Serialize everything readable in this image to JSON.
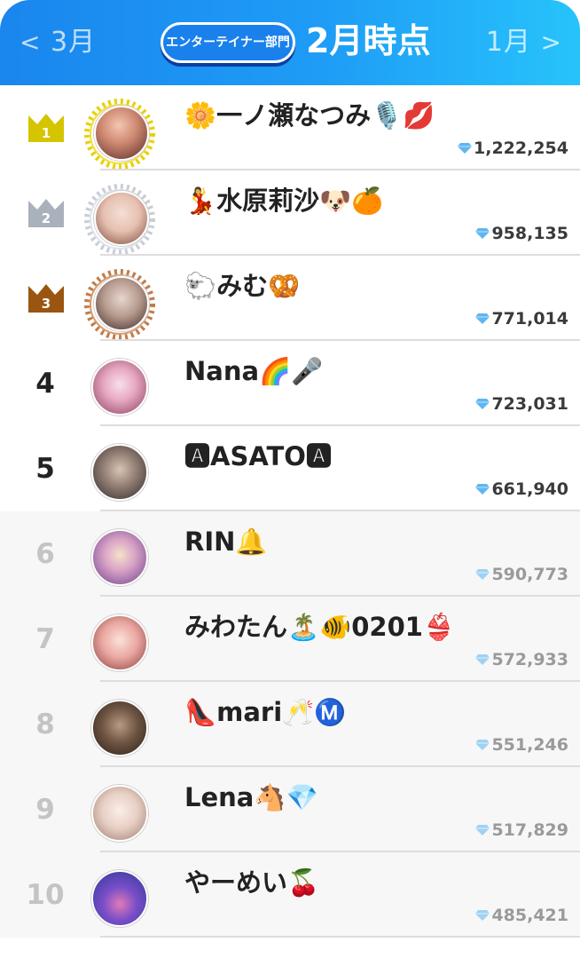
{
  "header": {
    "prev_label": "3月",
    "next_label": "1月",
    "prev_chevron": "<",
    "next_chevron": ">",
    "department": "エンターテイナー部門",
    "title": "2月時点"
  },
  "colors": {
    "header_start": "#1a86ee",
    "header_end": "#27c3fb",
    "gold": "#d5c400",
    "silver": "#a9b1bd",
    "bronze": "#9a5610",
    "diamond": "#5fb6f0"
  },
  "rows": [
    {
      "rank": "1",
      "medal": "gold",
      "name": "🌼一ノ瀬なつみ🎙️💋",
      "score": "1,222,254"
    },
    {
      "rank": "2",
      "medal": "silver",
      "name": "💃水原莉沙🐶🍊",
      "score": "958,135"
    },
    {
      "rank": "3",
      "medal": "bronze",
      "name": "🐑みむ🥨",
      "score": "771,014"
    },
    {
      "rank": "4",
      "medal": "",
      "name": "Nana🌈🎤",
      "score": "723,031"
    },
    {
      "rank": "5",
      "medal": "",
      "name": "🅰ASATO🅰",
      "score": "661,940"
    },
    {
      "rank": "6",
      "medal": "",
      "name": "RIN🔔",
      "score": "590,773"
    },
    {
      "rank": "7",
      "medal": "",
      "name": "みわたん🏝️🐠0201👙",
      "score": "572,933"
    },
    {
      "rank": "8",
      "medal": "",
      "name": "👠mari🥂Ⓜ️",
      "score": "551,246"
    },
    {
      "rank": "9",
      "medal": "",
      "name": "Lena🐴💎",
      "score": "517,829"
    },
    {
      "rank": "10",
      "medal": "",
      "name": "やーめい🍒",
      "score": "485,421"
    }
  ]
}
